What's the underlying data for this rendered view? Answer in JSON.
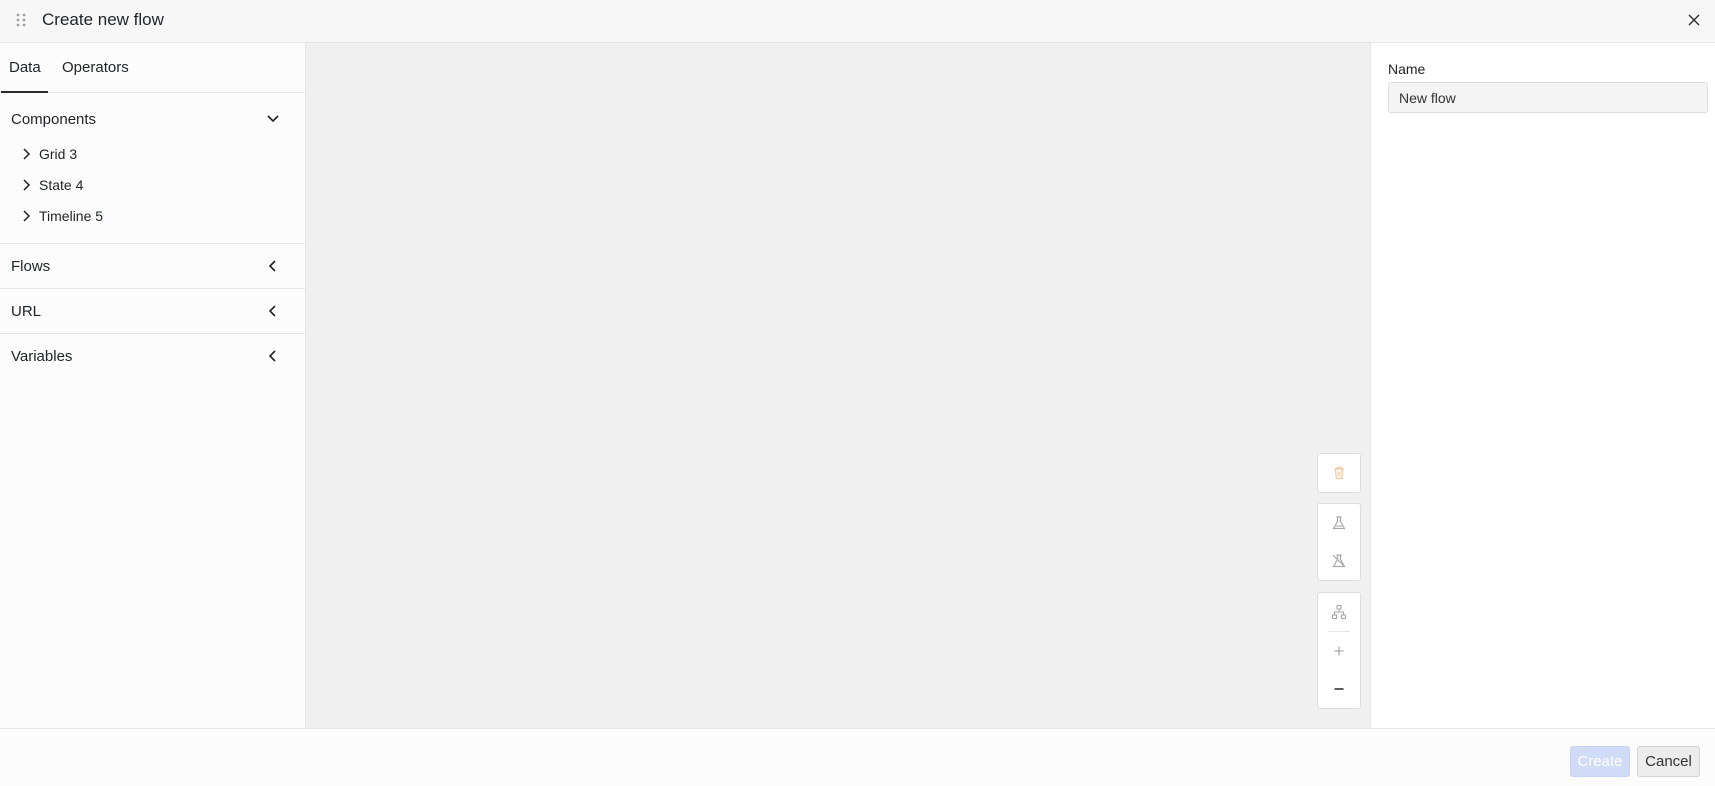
{
  "header": {
    "title": "Create new flow"
  },
  "left_panel": {
    "tabs": [
      {
        "label": "Data",
        "active": true
      },
      {
        "label": "Operators",
        "active": false
      }
    ],
    "sections": {
      "components": {
        "title": "Components",
        "expanded": true,
        "items": [
          {
            "label": "Grid 3"
          },
          {
            "label": "State 4"
          },
          {
            "label": "Timeline 5"
          }
        ]
      },
      "flows": {
        "title": "Flows",
        "expanded": false
      },
      "url": {
        "title": "URL",
        "expanded": false
      },
      "variables": {
        "title": "Variables",
        "expanded": false
      }
    }
  },
  "canvas": {
    "background": "#eff0ef",
    "tools": [
      "trash-icon",
      "flask-icon",
      "flask-off-icon",
      "hierarchy-icon",
      "zoom-in-icon",
      "zoom-out-icon"
    ]
  },
  "right_panel": {
    "name_label": "Name",
    "name_value": "New flow"
  },
  "footer": {
    "create_label": "Create",
    "cancel_label": "Cancel"
  },
  "colors": {
    "accent_disabled": "#d0dbf7",
    "trash_icon": "#f3c79a"
  }
}
